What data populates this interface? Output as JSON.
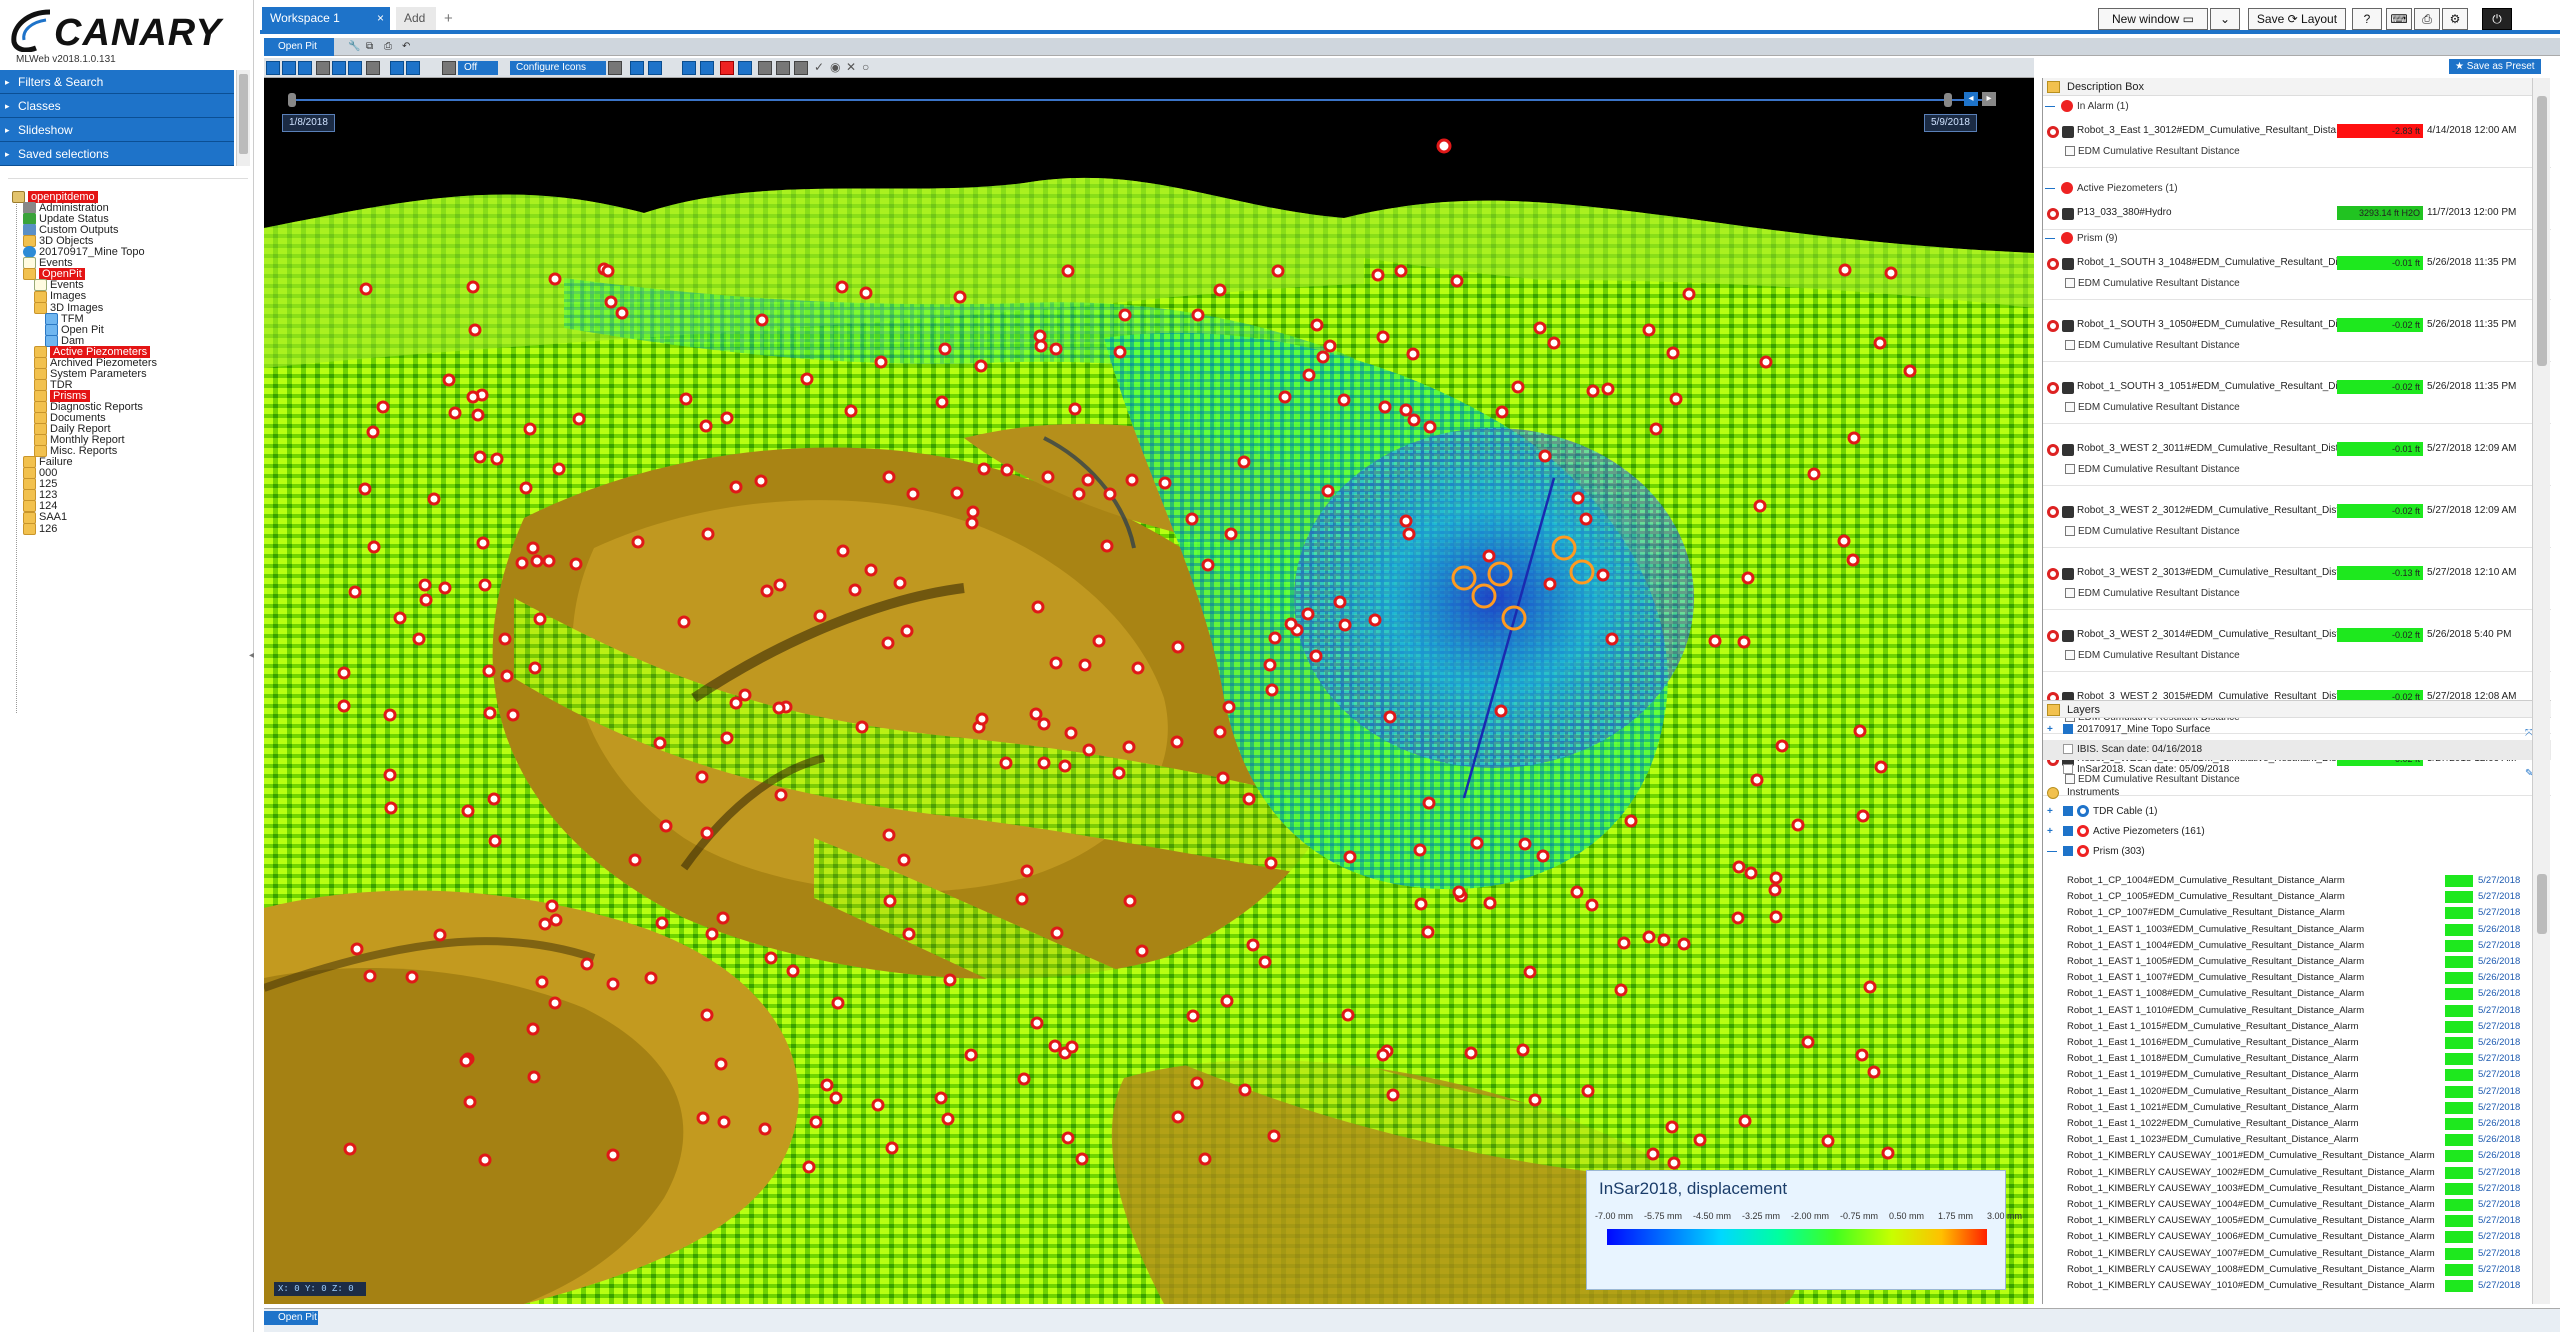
{
  "brand": {
    "name": "CANARY",
    "version": "MLWeb v2018.1.0.131"
  },
  "accordion": [
    "Filters & Search",
    "Classes",
    "Slideshow",
    "Saved selections"
  ],
  "tree": [
    {
      "label": "openpitdemo",
      "level": 0,
      "icon": "db",
      "hl": true
    },
    {
      "label": "Administration",
      "level": 1,
      "icon": "admin"
    },
    {
      "label": "Update Status",
      "level": 1,
      "icon": "check"
    },
    {
      "label": "Custom Outputs",
      "level": 1,
      "icon": "out"
    },
    {
      "label": "3D Objects",
      "level": 1,
      "icon": "folder"
    },
    {
      "label": "20170917_Mine Topo",
      "level": 1,
      "icon": "globe"
    },
    {
      "label": "Events",
      "level": 1,
      "icon": "grid"
    },
    {
      "label": "OpenPit",
      "level": 1,
      "icon": "folder",
      "hl": true
    },
    {
      "label": "Events",
      "level": 2,
      "icon": "grid"
    },
    {
      "label": "Images",
      "level": 2,
      "icon": "folder"
    },
    {
      "label": "3D Images",
      "level": 2,
      "icon": "folder"
    },
    {
      "label": "TFM",
      "level": 3,
      "icon": "cube"
    },
    {
      "label": "Open Pit",
      "level": 3,
      "icon": "cube"
    },
    {
      "label": "Dam",
      "level": 3,
      "icon": "cube"
    },
    {
      "label": "Active Piezometers",
      "level": 2,
      "icon": "folder",
      "hl": true
    },
    {
      "label": "Archived Piezometers",
      "level": 2,
      "icon": "folder"
    },
    {
      "label": "System Parameters",
      "level": 2,
      "icon": "folder"
    },
    {
      "label": "TDR",
      "level": 2,
      "icon": "folder"
    },
    {
      "label": "Prisms",
      "level": 2,
      "icon": "folder",
      "hl": true
    },
    {
      "label": "Diagnostic Reports",
      "level": 2,
      "icon": "folder"
    },
    {
      "label": "Documents",
      "level": 2,
      "icon": "folder"
    },
    {
      "label": "Daily Report",
      "level": 2,
      "icon": "folder"
    },
    {
      "label": "Monthly Report",
      "level": 2,
      "icon": "folder"
    },
    {
      "label": "Misc. Reports",
      "level": 2,
      "icon": "folder"
    },
    {
      "label": "Failure",
      "level": 1,
      "icon": "folder"
    },
    {
      "label": "000",
      "level": 1,
      "icon": "folder"
    },
    {
      "label": "125",
      "level": 1,
      "icon": "folder"
    },
    {
      "label": "123",
      "level": 1,
      "icon": "folder"
    },
    {
      "label": "124",
      "level": 1,
      "icon": "folder"
    },
    {
      "label": "SAA1",
      "level": 1,
      "icon": "folder"
    },
    {
      "label": "126",
      "level": 1,
      "icon": "folder"
    }
  ],
  "tabs": {
    "workspace": "Workspace 1",
    "close": "×",
    "add": "Add",
    "plus": "+"
  },
  "topbar": {
    "new_window": "New window",
    "save": "Save",
    "layout": "Layout",
    "help": "?"
  },
  "view": {
    "tab": "Open Pit",
    "toggle": "Off",
    "configure": "Configure Icons",
    "coords": "X: 0 Y: 0 Z: 0"
  },
  "timeline": {
    "start": "1/8/2018",
    "end": "5/9/2018"
  },
  "legend": {
    "title": "InSar2018, displacement",
    "ticks": [
      "-7.00 mm",
      "-5.75 mm",
      "-4.50 mm",
      "-3.25 mm",
      "-2.00 mm",
      "-0.75 mm",
      "0.50 mm",
      "1.75 mm",
      "3.00 mm"
    ]
  },
  "right": {
    "desc_title": "Description Box",
    "save_preset": "Save as Preset",
    "sections": [
      {
        "title": "In Alarm (1)",
        "rows": [
          {
            "name": "Robot_3_East 1_3012#EDM_Cumulative_Resultant_Dista...",
            "value": "-2.83 ft",
            "color": "#ff1010",
            "date": "4/14/2018 12:00 AM",
            "sub": "EDM Cumulative Resultant Distance"
          }
        ]
      },
      {
        "title": "Active Piezometers (1)",
        "rows": [
          {
            "name": "P13_033_380#Hydro",
            "value": "3293.14 ft H2O",
            "color": "#21c321",
            "date": "11/7/2013 12:00 PM",
            "sub": ""
          }
        ]
      },
      {
        "title": "Prism (9)",
        "rows": [
          {
            "name": "Robot_1_SOUTH 3_1048#EDM_Cumulative_Resultant_Di...",
            "value": "-0.01 ft",
            "color": "#1ee81e",
            "date": "5/26/2018 11:35 PM",
            "sub": "EDM Cumulative Resultant Distance"
          },
          {
            "name": "Robot_1_SOUTH 3_1050#EDM_Cumulative_Resultant_Di...",
            "value": "-0.02 ft",
            "color": "#1ee81e",
            "date": "5/26/2018 11:35 PM",
            "sub": "EDM Cumulative Resultant Distance"
          },
          {
            "name": "Robot_1_SOUTH 3_1051#EDM_Cumulative_Resultant_Di...",
            "value": "-0.02 ft",
            "color": "#1ee81e",
            "date": "5/26/2018 11:35 PM",
            "sub": "EDM Cumulative Resultant Distance"
          },
          {
            "name": "Robot_3_WEST 2_3011#EDM_Cumulative_Resultant_Dist...",
            "value": "-0.01 ft",
            "color": "#1ee81e",
            "date": "5/27/2018 12:09 AM",
            "sub": "EDM Cumulative Resultant Distance"
          },
          {
            "name": "Robot_3_WEST 2_3012#EDM_Cumulative_Resultant_Dist...",
            "value": "-0.02 ft",
            "color": "#1ee81e",
            "date": "5/27/2018 12:09 AM",
            "sub": "EDM Cumulative Resultant Distance"
          },
          {
            "name": "Robot_3_WEST 2_3013#EDM_Cumulative_Resultant_Dist...",
            "value": "-0.13 ft",
            "color": "#1ee81e",
            "date": "5/27/2018 12:10 AM",
            "sub": "EDM Cumulative Resultant Distance"
          },
          {
            "name": "Robot_3_WEST 2_3014#EDM_Cumulative_Resultant_Dist...",
            "value": "-0.02 ft",
            "color": "#1ee81e",
            "date": "5/26/2018 5:40 PM",
            "sub": "EDM Cumulative Resultant Distance"
          },
          {
            "name": "Robot_3_WEST 2_3015#EDM_Cumulative_Resultant_Dist...",
            "value": "-0.02 ft",
            "color": "#1ee81e",
            "date": "5/27/2018 12:08 AM",
            "sub": "EDM Cumulative Resultant Distance"
          },
          {
            "name": "Robot_3_WEST 2_3016#EDM_Cumulative_Resultant_Dist...",
            "value": "-0.02 ft",
            "color": "#1ee81e",
            "date": "5/27/2018 12:09 AM",
            "sub": "EDM Cumulative Resultant Distance"
          }
        ]
      }
    ],
    "layers_title": "Layers",
    "layers": [
      {
        "label": "20170917_Mine Topo Surface",
        "checked": true,
        "shade": false
      },
      {
        "label": "IBIS. Scan date: 04/16/2018",
        "checked": false,
        "shade": true
      },
      {
        "label": "InSar2018. Scan date: 05/09/2018",
        "checked": false,
        "shade": false
      }
    ],
    "instruments_title": "Instruments",
    "instrument_groups": [
      "TDR Cable (1)",
      "Active Piezometers (161)",
      "Prism (303)"
    ],
    "prism_list": [
      {
        "n": "Robot_1_CP_1004#EDM_Cumulative_Resultant_Distance_Alarm",
        "d": "5/27/2018"
      },
      {
        "n": "Robot_1_CP_1005#EDM_Cumulative_Resultant_Distance_Alarm",
        "d": "5/27/2018"
      },
      {
        "n": "Robot_1_CP_1007#EDM_Cumulative_Resultant_Distance_Alarm",
        "d": "5/27/2018"
      },
      {
        "n": "Robot_1_EAST 1_1003#EDM_Cumulative_Resultant_Distance_Alarm",
        "d": "5/26/2018"
      },
      {
        "n": "Robot_1_EAST 1_1004#EDM_Cumulative_Resultant_Distance_Alarm",
        "d": "5/27/2018"
      },
      {
        "n": "Robot_1_EAST 1_1005#EDM_Cumulative_Resultant_Distance_Alarm",
        "d": "5/26/2018"
      },
      {
        "n": "Robot_1_EAST 1_1007#EDM_Cumulative_Resultant_Distance_Alarm",
        "d": "5/26/2018"
      },
      {
        "n": "Robot_1_EAST 1_1008#EDM_Cumulative_Resultant_Distance_Alarm",
        "d": "5/26/2018"
      },
      {
        "n": "Robot_1_EAST 1_1010#EDM_Cumulative_Resultant_Distance_Alarm",
        "d": "5/27/2018"
      },
      {
        "n": "Robot_1_East 1_1015#EDM_Cumulative_Resultant_Distance_Alarm",
        "d": "5/27/2018"
      },
      {
        "n": "Robot_1_East 1_1016#EDM_Cumulative_Resultant_Distance_Alarm",
        "d": "5/26/2018"
      },
      {
        "n": "Robot_1_East 1_1018#EDM_Cumulative_Resultant_Distance_Alarm",
        "d": "5/27/2018"
      },
      {
        "n": "Robot_1_East 1_1019#EDM_Cumulative_Resultant_Distance_Alarm",
        "d": "5/27/2018"
      },
      {
        "n": "Robot_1_East 1_1020#EDM_Cumulative_Resultant_Distance_Alarm",
        "d": "5/27/2018"
      },
      {
        "n": "Robot_1_East 1_1021#EDM_Cumulative_Resultant_Distance_Alarm",
        "d": "5/27/2018"
      },
      {
        "n": "Robot_1_East 1_1022#EDM_Cumulative_Resultant_Distance_Alarm",
        "d": "5/26/2018"
      },
      {
        "n": "Robot_1_East 1_1023#EDM_Cumulative_Resultant_Distance_Alarm",
        "d": "5/26/2018"
      },
      {
        "n": "Robot_1_KIMBERLY CAUSEWAY_1001#EDM_Cumulative_Resultant_Distance_Alarm",
        "d": "5/26/2018"
      },
      {
        "n": "Robot_1_KIMBERLY CAUSEWAY_1002#EDM_Cumulative_Resultant_Distance_Alarm",
        "d": "5/27/2018"
      },
      {
        "n": "Robot_1_KIMBERLY CAUSEWAY_1003#EDM_Cumulative_Resultant_Distance_Alarm",
        "d": "5/27/2018"
      },
      {
        "n": "Robot_1_KIMBERLY CAUSEWAY_1004#EDM_Cumulative_Resultant_Distance_Alarm",
        "d": "5/27/2018"
      },
      {
        "n": "Robot_1_KIMBERLY CAUSEWAY_1005#EDM_Cumulative_Resultant_Distance_Alarm",
        "d": "5/27/2018"
      },
      {
        "n": "Robot_1_KIMBERLY CAUSEWAY_1006#EDM_Cumulative_Resultant_Distance_Alarm",
        "d": "5/27/2018"
      },
      {
        "n": "Robot_1_KIMBERLY CAUSEWAY_1007#EDM_Cumulative_Resultant_Distance_Alarm",
        "d": "5/27/2018"
      },
      {
        "n": "Robot_1_KIMBERLY CAUSEWAY_1008#EDM_Cumulative_Resultant_Distance_Alarm",
        "d": "5/27/2018"
      },
      {
        "n": "Robot_1_KIMBERLY CAUSEWAY_1010#EDM_Cumulative_Resultant_Distance_Alarm",
        "d": "5/27/2018"
      }
    ]
  }
}
